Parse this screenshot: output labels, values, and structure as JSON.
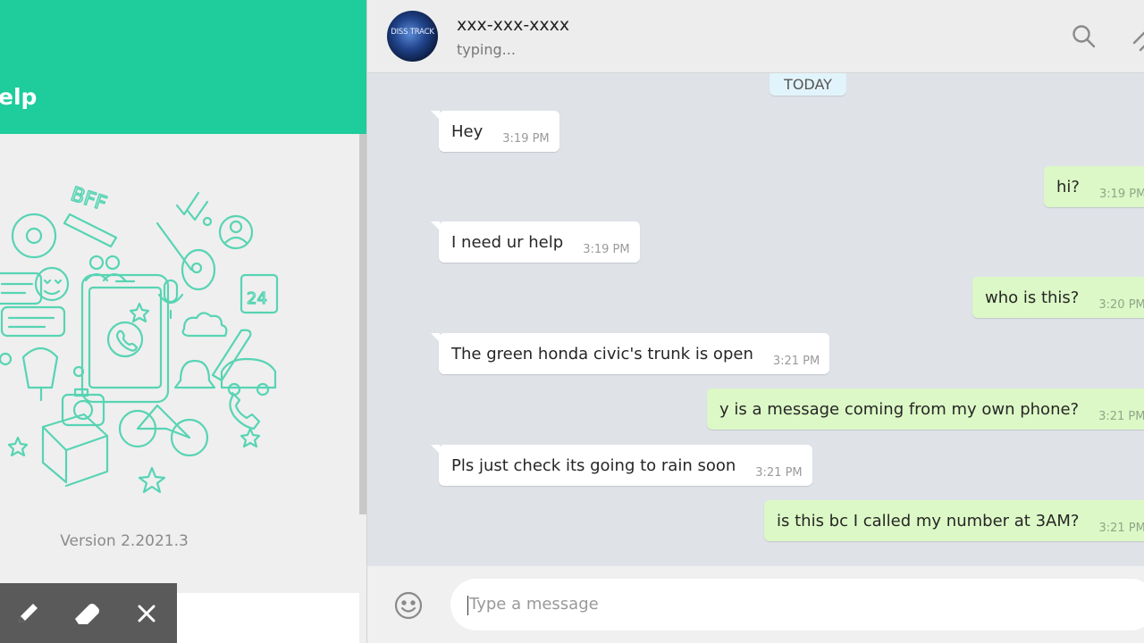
{
  "sidebar": {
    "title": "elp",
    "version": "Version 2.2021.3",
    "colors": {
      "header": "#1ecc9c",
      "doodle": "#57d4b3"
    }
  },
  "toolbar": {
    "icons": [
      "pencil-icon",
      "eraser-icon",
      "close-icon"
    ]
  },
  "chat": {
    "avatar_text": "DISS TRACK",
    "contact_name": "xxx-xxx-xxxx",
    "status": "typing...",
    "date_label": "TODAY",
    "header_icons": [
      "search-icon",
      "attach-icon"
    ]
  },
  "messages": [
    {
      "dir": "in",
      "text": "Hey",
      "time": "3:19 PM"
    },
    {
      "dir": "out",
      "text": "hi?",
      "time": "3:19 PM"
    },
    {
      "dir": "in",
      "text": "I need ur help",
      "time": "3:19 PM"
    },
    {
      "dir": "out",
      "text": "who is this?",
      "time": "3:20 PM"
    },
    {
      "dir": "in",
      "text": "The green honda civic's trunk is open",
      "time": "3:21 PM"
    },
    {
      "dir": "out",
      "text": "y is a message coming from my own phone?",
      "time": "3:21 PM"
    },
    {
      "dir": "in",
      "text": "Pls just check its going to rain soon",
      "time": "3:21 PM"
    },
    {
      "dir": "out",
      "text": "is this bc I called my number at 3AM?",
      "time": "3:21 PM"
    }
  ],
  "composer": {
    "placeholder": "Type a message",
    "emoji_icon": "smile-icon"
  }
}
